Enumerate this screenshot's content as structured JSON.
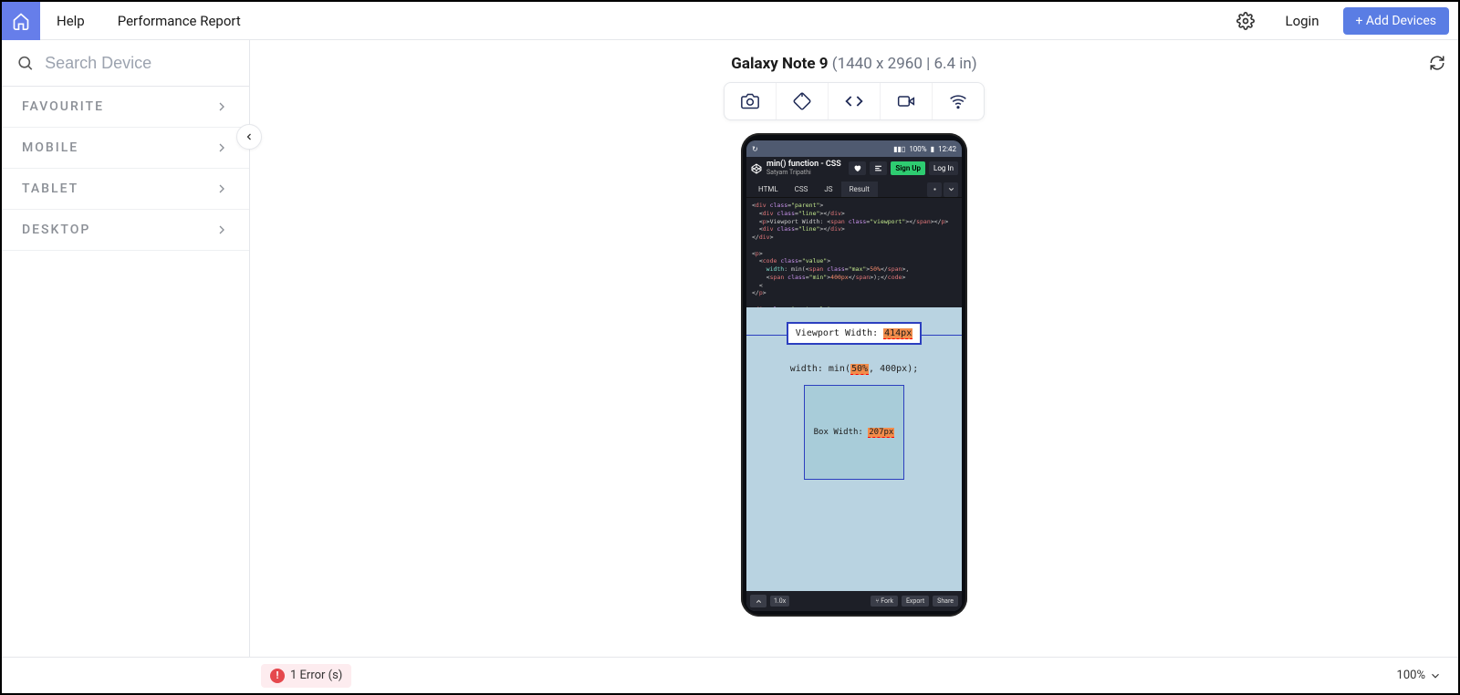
{
  "topbar": {
    "help": "Help",
    "perf_report": "Performance Report",
    "login": "Login",
    "add_devices": "+ Add Devices"
  },
  "sidebar": {
    "search_placeholder": "Search Device",
    "categories": [
      {
        "label": "FAVOURITE"
      },
      {
        "label": "MOBILE"
      },
      {
        "label": "TABLET"
      },
      {
        "label": "DESKTOP"
      }
    ]
  },
  "device": {
    "name": "Galaxy Note 9 ",
    "dims": "(1440 x 2960 | 6.4 in)"
  },
  "phone": {
    "status_time": "12:42",
    "status_battery": "100%",
    "codepen_title": "min() function - CSS",
    "codepen_author": "Satyam Tripathi",
    "btn_signup": "Sign Up",
    "btn_login": "Log In",
    "tabs": {
      "html": "HTML",
      "css": "CSS",
      "js": "JS",
      "result": "Result"
    },
    "result": {
      "vw_label": "Viewport Width: ",
      "vw_value": "414px",
      "code_pre": "width: min(",
      "code_hl": "50%",
      "code_post": ", 400px);",
      "bw_label": "Box Width: ",
      "bw_value": "207px"
    },
    "footer": {
      "scale": "1.0x",
      "fork": "Fork",
      "export": "Export",
      "share": "Share"
    }
  },
  "status": {
    "error_count": "1 Error (s)",
    "zoom": "100%"
  }
}
